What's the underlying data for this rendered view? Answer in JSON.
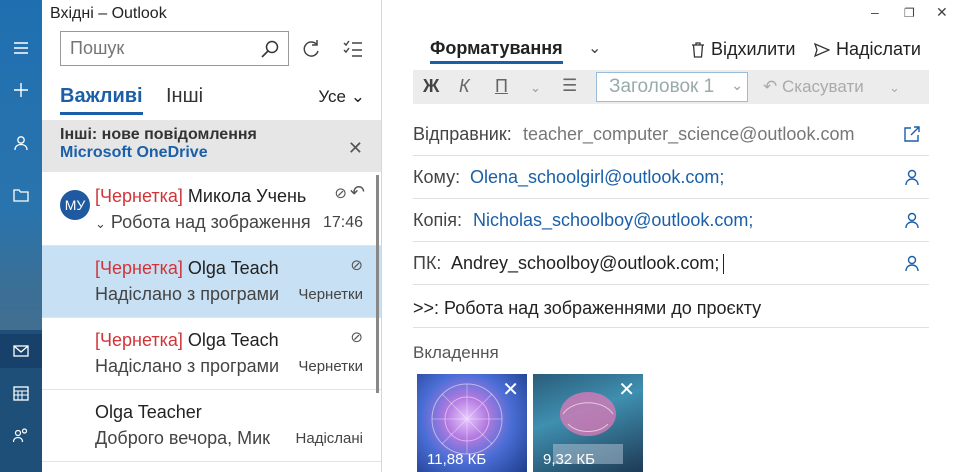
{
  "window": {
    "title": "Вхідні – Outlook"
  },
  "colors": {
    "accent": "#1a5fa8",
    "draft": "#d13438",
    "selected_row": "#c7e0f4"
  },
  "rail": {
    "icons": [
      "hamburger-icon",
      "plus-icon",
      "person-icon",
      "folder-icon",
      "mail-icon",
      "calendar-icon",
      "people-icon"
    ]
  },
  "search": {
    "placeholder": "Пошук"
  },
  "tabs": {
    "focused": "Важливі",
    "other": "Інші",
    "filter": "Усе"
  },
  "banner": {
    "line1": "Інші: нове повідомлення",
    "line2": "Microsoft OneDrive",
    "close": "✕"
  },
  "messages": [
    {
      "avatar": "МУ",
      "draft_tag": "[Чернетка]",
      "sender": " Микола Учень",
      "preview": "Робота над зображення",
      "meta": "17:46",
      "attachment": true
    },
    {
      "draft_tag": "[Чернетка]",
      "sender": " Olga Teach",
      "preview": "Надіслано з програми",
      "meta": "Чернетки",
      "attachment": true
    },
    {
      "draft_tag": "[Чернетка]",
      "sender": " Olga Teach",
      "preview": "Надіслано з програми",
      "meta": "Чернетки",
      "attachment": true
    },
    {
      "sender": "Olga Teacher",
      "preview": "Доброго вечора, Мик",
      "meta": "Надіслані"
    }
  ],
  "compose": {
    "tab": "Форматування",
    "discard": "Відхилити",
    "send": "Надіслати",
    "toolbar": {
      "bold": "Ж",
      "italic": "К",
      "underline": "П",
      "style": "Заголовок 1",
      "undo": "Скасувати"
    },
    "from_label": "Відправник:",
    "from": "teacher_computer_science@outlook.com",
    "to_label": "Кому:",
    "to": "Olena_schoolgirl@outlook.com;",
    "cc_label": "Копія:",
    "cc": "Nicholas_schoolboy@outlook.com;",
    "bcc_label": "ПК:",
    "bcc": "Andrey_schoolboy@outlook.com;",
    "subject": ">>: Робота над зображеннями до проєкту",
    "attachments_label": "Вкладення",
    "attachments": [
      {
        "size": "11,88 КБ"
      },
      {
        "size": "9,32 КБ"
      }
    ]
  }
}
